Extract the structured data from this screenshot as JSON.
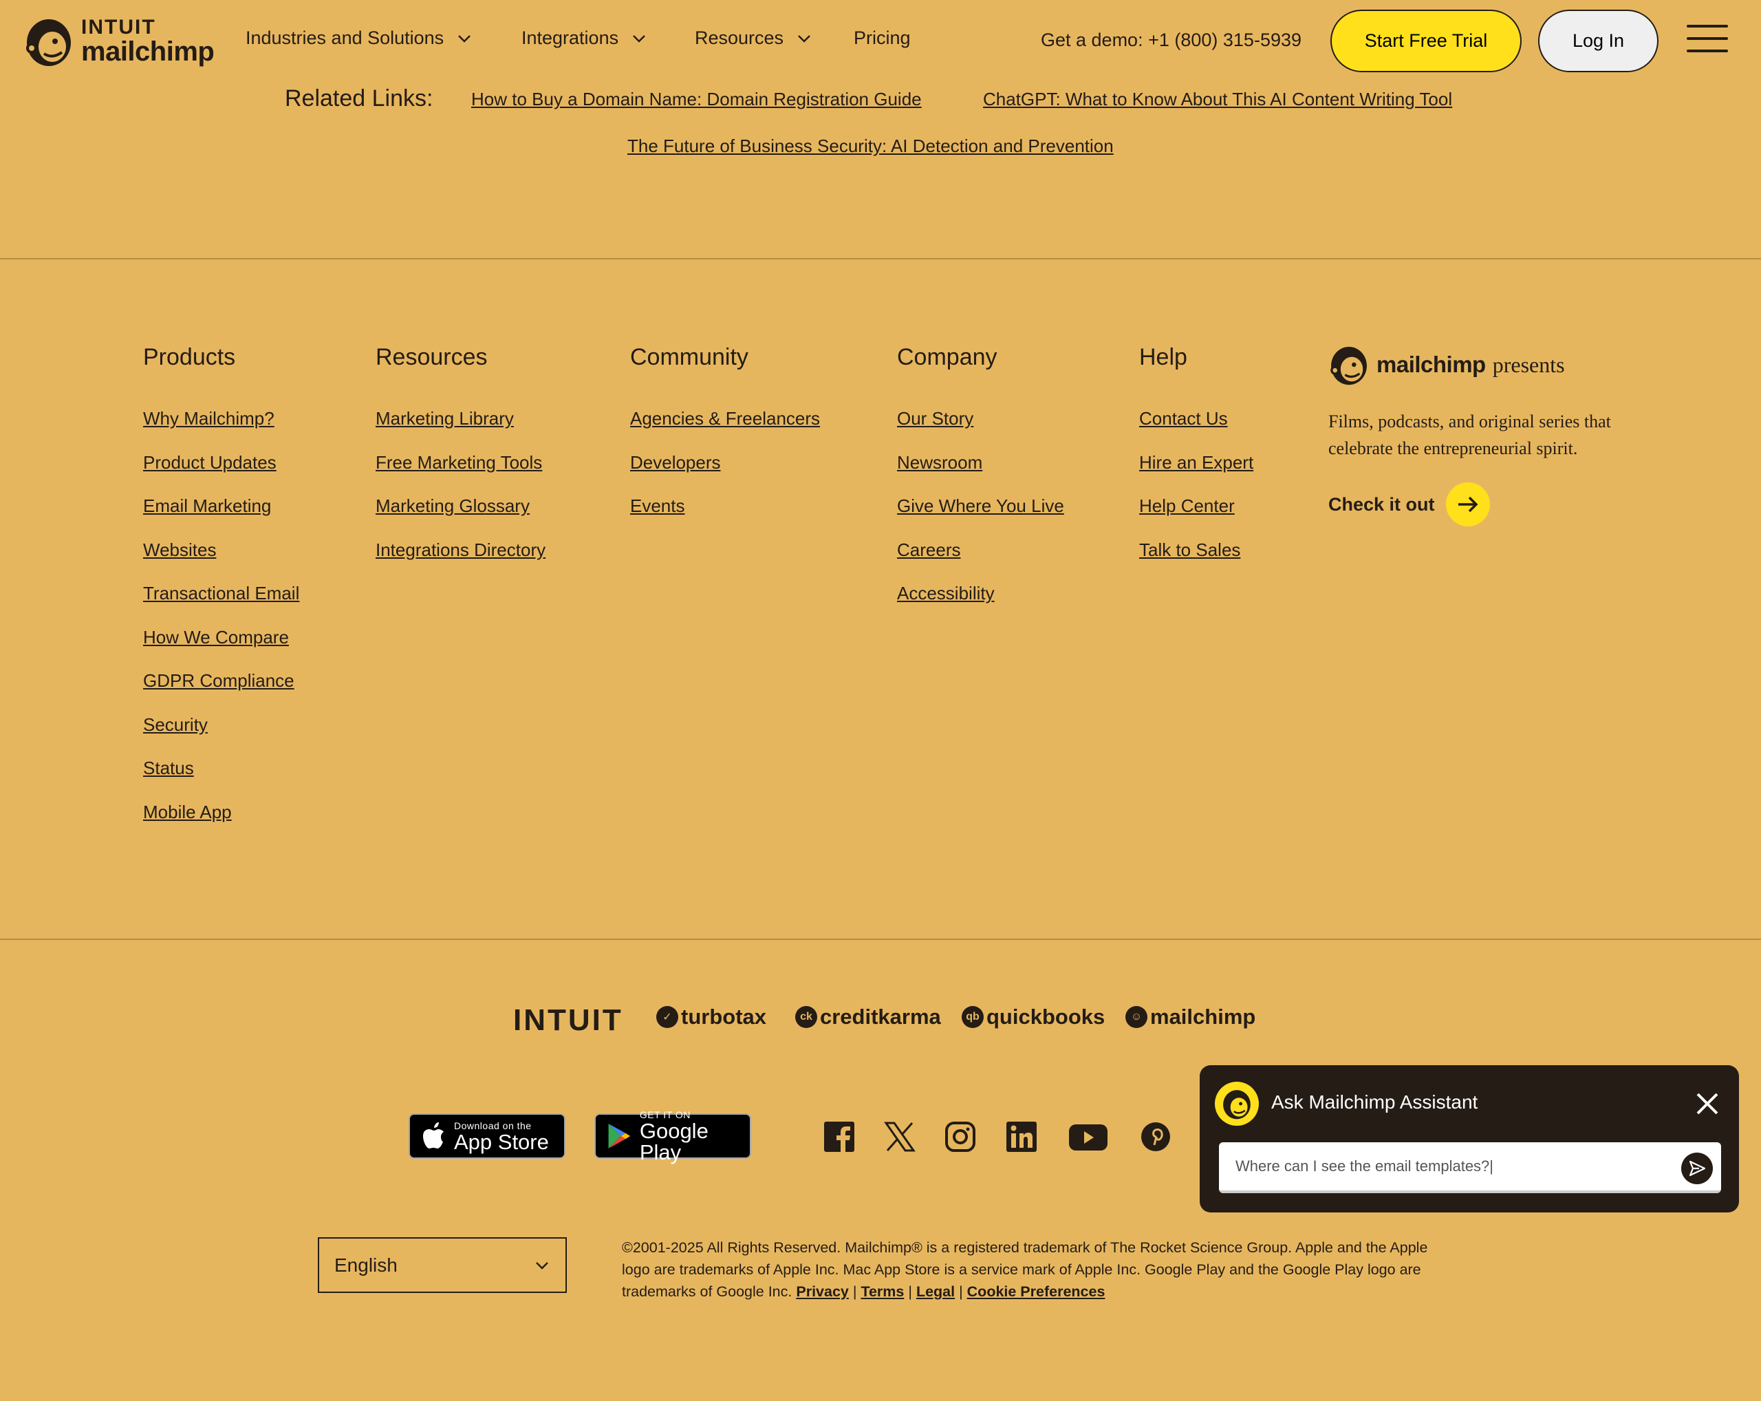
{
  "header": {
    "logo_intuit": "INTUIT",
    "logo_mailchimp": "mailchimp",
    "nav": [
      {
        "label": "Industries and Solutions",
        "has_dropdown": true
      },
      {
        "label": "Integrations",
        "has_dropdown": true
      },
      {
        "label": "Resources",
        "has_dropdown": true
      },
      {
        "label": "Pricing",
        "has_dropdown": false
      }
    ],
    "demo": "Get a demo: +1 (800) 315-5939",
    "start_trial": "Start Free Trial",
    "login": "Log In"
  },
  "related": {
    "label": "Related Links:",
    "links": [
      "How to Buy a Domain Name: Domain Registration Guide",
      "ChatGPT: What to Know About This AI Content Writing Tool",
      "The Future of Business Security: AI Detection and Prevention"
    ]
  },
  "footer": {
    "columns": [
      {
        "title": "Products",
        "links": [
          "Why Mailchimp?",
          "Product Updates",
          "Email Marketing",
          "Websites",
          "Transactional Email",
          "How We Compare",
          "GDPR Compliance",
          "Security",
          "Status",
          "Mobile App"
        ]
      },
      {
        "title": "Resources",
        "links": [
          "Marketing Library",
          "Free Marketing Tools",
          "Marketing Glossary",
          "Integrations Directory"
        ]
      },
      {
        "title": "Community",
        "links": [
          "Agencies & Freelancers",
          "Developers",
          "Events"
        ]
      },
      {
        "title": "Company",
        "links": [
          "Our Story",
          "Newsroom",
          "Give Where You Live",
          "Careers",
          "Accessibility"
        ]
      },
      {
        "title": "Help",
        "links": [
          "Contact Us",
          "Hire an Expert",
          "Help Center",
          "Talk to Sales"
        ]
      }
    ],
    "presents": {
      "brand": "mailchimp",
      "word": "presents",
      "description": "Films, podcasts, and original series that celebrate the entrepreneurial spirit.",
      "cta": "Check it out"
    }
  },
  "brands": [
    "INTUIT",
    "turbotax",
    "creditkarma",
    "quickbooks",
    "mailchimp"
  ],
  "stores": {
    "apple_small": "Download on the",
    "apple_big": "App Store",
    "google_small": "GET IT ON",
    "google_big": "Google Play"
  },
  "social_icons": [
    "facebook-icon",
    "x-icon",
    "instagram-icon",
    "linkedin-icon",
    "youtube-icon",
    "pinterest-icon"
  ],
  "language": {
    "selected": "English"
  },
  "legal": {
    "text": "©2001-2025 All Rights Reserved. Mailchimp® is a registered trademark of The Rocket Science Group. Apple and the Apple logo are trademarks of Apple Inc. Mac App Store is a service mark of Apple Inc. Google Play and the Google Play logo are trademarks of Google Inc.",
    "privacy": "Privacy",
    "terms": "Terms",
    "legal": "Legal",
    "cookies": "Cookie Preferences",
    "separator": "|"
  },
  "assistant": {
    "title": "Ask Mailchimp Assistant",
    "input_value": "Where can I see the email templates?|"
  },
  "colors": {
    "background": "#e6b65f",
    "primary_yellow": "#ffe01b",
    "ink": "#241c15"
  }
}
